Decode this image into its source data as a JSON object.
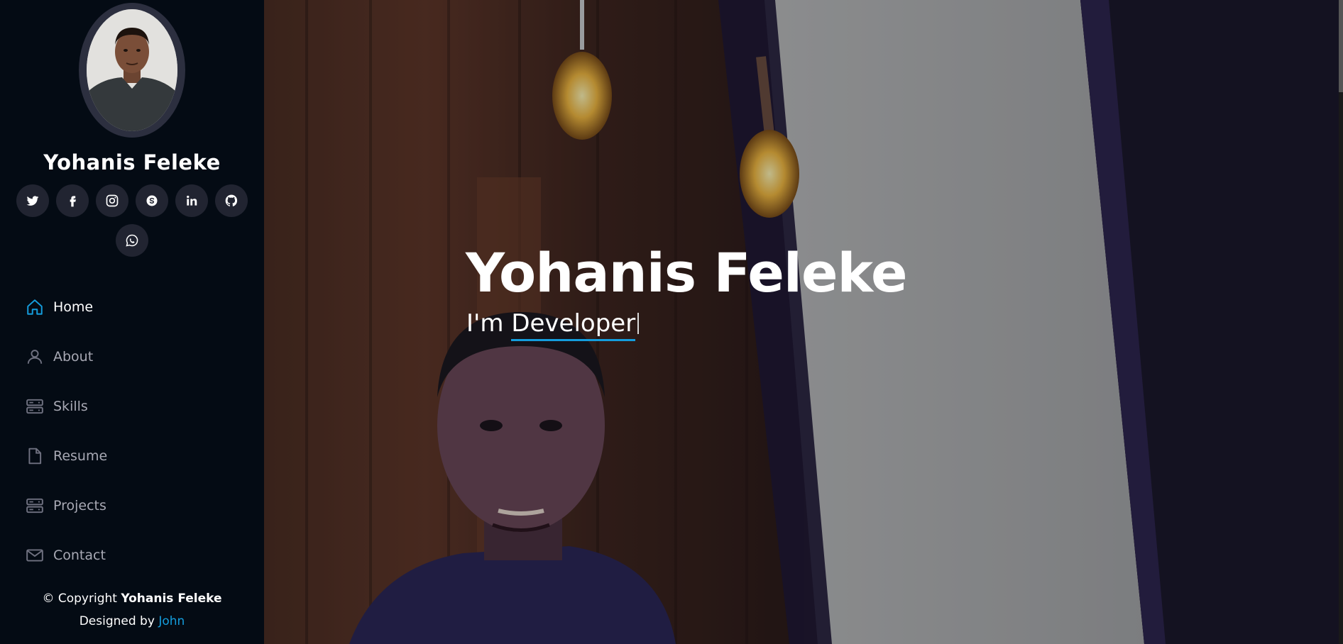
{
  "profile": {
    "name": "Yohanis Feleke"
  },
  "social": [
    {
      "name": "twitter-icon"
    },
    {
      "name": "facebook-icon"
    },
    {
      "name": "instagram-icon"
    },
    {
      "name": "skype-icon"
    },
    {
      "name": "linkedin-icon"
    },
    {
      "name": "github-icon"
    },
    {
      "name": "whatsapp-icon"
    }
  ],
  "nav": {
    "items": [
      {
        "label": "Home",
        "icon": "home-icon",
        "active": true
      },
      {
        "label": "About",
        "icon": "person-icon"
      },
      {
        "label": "Skills",
        "icon": "server-icon"
      },
      {
        "label": "Resume",
        "icon": "file-icon"
      },
      {
        "label": "Projects",
        "icon": "server-icon"
      },
      {
        "label": "Contact",
        "icon": "envelope-icon"
      }
    ]
  },
  "footer": {
    "copyright_prefix": "© Copyright ",
    "copyright_name": "Yohanis Feleke",
    "designed_prefix": "Designed by ",
    "designer": "John"
  },
  "hero": {
    "title": "Yohanis Feleke",
    "prefix": "I'm ",
    "typed": "Developer"
  },
  "colors": {
    "accent": "#149ddd",
    "sidebar_bg": "#040b14",
    "social_bg": "#212431",
    "nav_inactive": "#a8a9b4"
  }
}
